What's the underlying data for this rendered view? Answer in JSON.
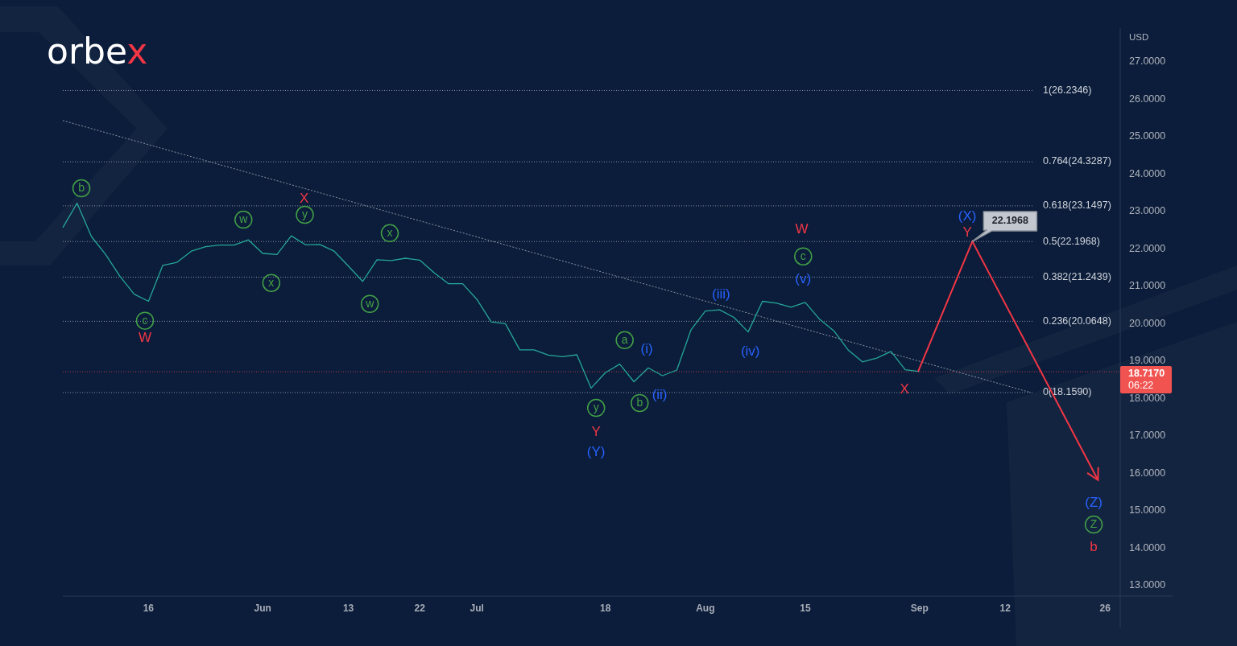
{
  "logo": {
    "text": "orbe",
    "accent": "x"
  },
  "chart": {
    "chart_data": {
      "type": "line",
      "ylabel": "USD",
      "categories": [
        null,
        null,
        null,
        null,
        null,
        null,
        "16",
        null,
        null,
        null,
        null,
        null,
        null,
        null,
        "Jun",
        null,
        null,
        null,
        null,
        null,
        "13",
        null,
        null,
        null,
        null,
        "22",
        null,
        null,
        null,
        "Jul",
        null,
        null,
        null,
        null,
        null,
        null,
        null,
        null,
        "18",
        null,
        null,
        null,
        null,
        null,
        null,
        "Aug",
        null,
        null,
        null,
        null,
        null,
        null,
        "15",
        null,
        null,
        null,
        null,
        null,
        null,
        null,
        "Sep",
        null,
        null,
        null,
        null,
        null,
        "12",
        null,
        null,
        null,
        null,
        null,
        null,
        "26"
      ],
      "series": [
        {
          "color": "#26a69a",
          "values": [
            22.57,
            23.22,
            22.33,
            21.85,
            21.27,
            20.79,
            20.6,
            21.56,
            21.64,
            21.94,
            22.06,
            22.1,
            22.1,
            22.24,
            21.88,
            21.85,
            22.35,
            22.11,
            22.12,
            21.94,
            21.54,
            21.13,
            21.71,
            21.69,
            21.75,
            21.7,
            21.36,
            21.07,
            21.07,
            20.65,
            20.05,
            20.0,
            19.3,
            19.3,
            19.16,
            19.12,
            19.17,
            18.28,
            18.69,
            18.92,
            18.45,
            18.82,
            18.61,
            18.76,
            19.84,
            20.34,
            20.37,
            20.17,
            19.78,
            20.6,
            20.55,
            20.44,
            20.57,
            20.12,
            19.81,
            19.3,
            18.98,
            19.08,
            19.26,
            18.77,
            18.72,
            null,
            null,
            null,
            null,
            null,
            null,
            null,
            null,
            null,
            null,
            null,
            null,
            null
          ]
        }
      ],
      "ylim": [
        11.88,
        27.9
      ],
      "ref_lines": [
        {
          "axis": "y",
          "value": 18.717,
          "color": "#b83a45"
        }
      ],
      "yticks": [
        {
          "value": 27,
          "label": "27.0000"
        },
        {
          "value": 26,
          "label": "26.0000"
        },
        {
          "value": 25,
          "label": "25.0000"
        },
        {
          "value": 24,
          "label": "24.0000"
        },
        {
          "value": 23,
          "label": "23.0000"
        },
        {
          "value": 22,
          "label": "22.0000"
        },
        {
          "value": 21,
          "label": "21.0000"
        },
        {
          "value": 20,
          "label": "20.0000"
        },
        {
          "value": 19,
          "label": "19.0000"
        },
        {
          "value": 18,
          "label": "18.0000"
        },
        {
          "value": 17,
          "label": "17.0000"
        },
        {
          "value": 16,
          "label": "16.0000"
        },
        {
          "value": 15,
          "label": "15.0000"
        },
        {
          "value": 14,
          "label": "14.0000"
        },
        {
          "value": 13,
          "label": "13.0000"
        }
      ]
    },
    "fib_levels": [
      "1(26.2346)",
      "0.764(24.3287)",
      "0.618(23.1497)",
      "0.5(22.1968)",
      "0.382(21.2439)",
      "0.236(20.0648)",
      "0(18.1590)"
    ],
    "wave_labels": [
      {
        "text": "b",
        "kind": "circled",
        "color": "#43a047"
      },
      {
        "text": "c",
        "kind": "circled",
        "color": "#43a047"
      },
      {
        "text": "W",
        "kind": "plain",
        "color": "#f23645"
      },
      {
        "text": "w",
        "kind": "circled",
        "color": "#43a047"
      },
      {
        "text": "x",
        "kind": "circled",
        "color": "#43a047"
      },
      {
        "text": "X",
        "kind": "plain",
        "color": "#f23645"
      },
      {
        "text": "y",
        "kind": "circled",
        "color": "#43a047"
      },
      {
        "text": "w",
        "kind": "circled",
        "color": "#43a047"
      },
      {
        "text": "x",
        "kind": "circled",
        "color": "#43a047"
      },
      {
        "text": "y",
        "kind": "circled",
        "color": "#43a047"
      },
      {
        "text": "Y",
        "kind": "plain",
        "color": "#f23645"
      },
      {
        "text": "(Y)",
        "kind": "plain",
        "color": "#2962ff"
      },
      {
        "text": "a",
        "kind": "circled",
        "color": "#43a047"
      },
      {
        "text": "(i)",
        "kind": "plain",
        "color": "#2962ff"
      },
      {
        "text": "b",
        "kind": "circled",
        "color": "#43a047"
      },
      {
        "text": "(ii)",
        "kind": "plain",
        "color": "#2962ff"
      },
      {
        "text": "(iii)",
        "kind": "plain",
        "color": "#2962ff"
      },
      {
        "text": "(iv)",
        "kind": "plain",
        "color": "#2962ff"
      },
      {
        "text": "W",
        "kind": "plain",
        "color": "#f23645"
      },
      {
        "text": "c",
        "kind": "circled",
        "color": "#43a047"
      },
      {
        "text": "(v)",
        "kind": "plain",
        "color": "#2962ff"
      },
      {
        "text": "X",
        "kind": "plain",
        "color": "#f23645"
      },
      {
        "text": "(X)",
        "kind": "plain",
        "color": "#2962ff"
      },
      {
        "text": "Y",
        "kind": "plain",
        "color": "#f23645"
      },
      {
        "text": "(Z)",
        "kind": "plain",
        "color": "#2962ff"
      },
      {
        "text": "Z",
        "kind": "circled",
        "color": "#43a047"
      },
      {
        "text": "b",
        "kind": "plain",
        "color": "#f23645"
      }
    ],
    "callout": "22.1968",
    "last_price": {
      "price": "18.7170",
      "countdown": "06:22"
    }
  }
}
